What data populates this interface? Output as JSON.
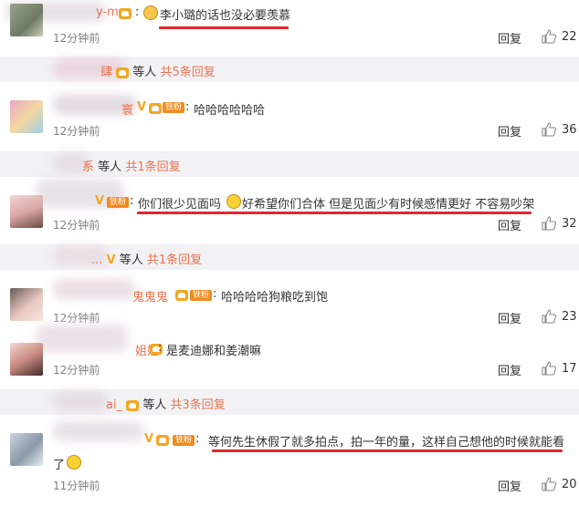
{
  "comments": [
    {
      "name": "y-m",
      "colon": ":",
      "text": "李小璐的话也没必要羡慕",
      "time": "12分钟前",
      "reply": "回复",
      "likes": "22"
    },
    {
      "name": "寰",
      "colon": ":",
      "text": "哈哈哈哈哈哈",
      "time": "12分钟前",
      "reply": "回复",
      "likes": "36",
      "badge": "铁粉"
    },
    {
      "name": "",
      "colon": ":",
      "text_part1": "你们很少见面吗",
      "text_part2": "好希望你们合体 但是见面少有时候感情更好 不容易吵架",
      "time": "12分钟前",
      "reply": "回复",
      "likes": "32",
      "badge": "铁粉"
    },
    {
      "name": "鬼鬼鬼",
      "colon": ":",
      "text": "哈哈哈哈狗粮吃到饱",
      "time": "12分钟前",
      "reply": "回复",
      "likes": "23",
      "badge": "铁粉"
    },
    {
      "name": "姐姐",
      "colon": ":",
      "text": "是麦迪娜和姜潮嘛",
      "time": "12分钟前",
      "reply": "回复",
      "likes": "17"
    },
    {
      "name": "",
      "colon": ":",
      "text": "等何先生休假了就多拍点，拍一年的量，这样自己想他的时候就能看",
      "text_cont": "了",
      "time": "11分钟前",
      "reply": "回复",
      "likes": "20",
      "badge": "铁粉"
    }
  ],
  "subreplies": [
    {
      "name": "肆",
      "suffix": "等人",
      "count": "共5条回复"
    },
    {
      "name": "系",
      "suffix": "等人",
      "count": "共1条回复"
    },
    {
      "name": "...",
      "suffix": "等人",
      "count": "共1条回复"
    },
    {
      "name": "ai_",
      "suffix": "等人",
      "count": "共3条回复"
    }
  ],
  "colors": {
    "name": "#eb7350",
    "underline": "#e2282c",
    "sub_bg": "#f2f2f5"
  }
}
